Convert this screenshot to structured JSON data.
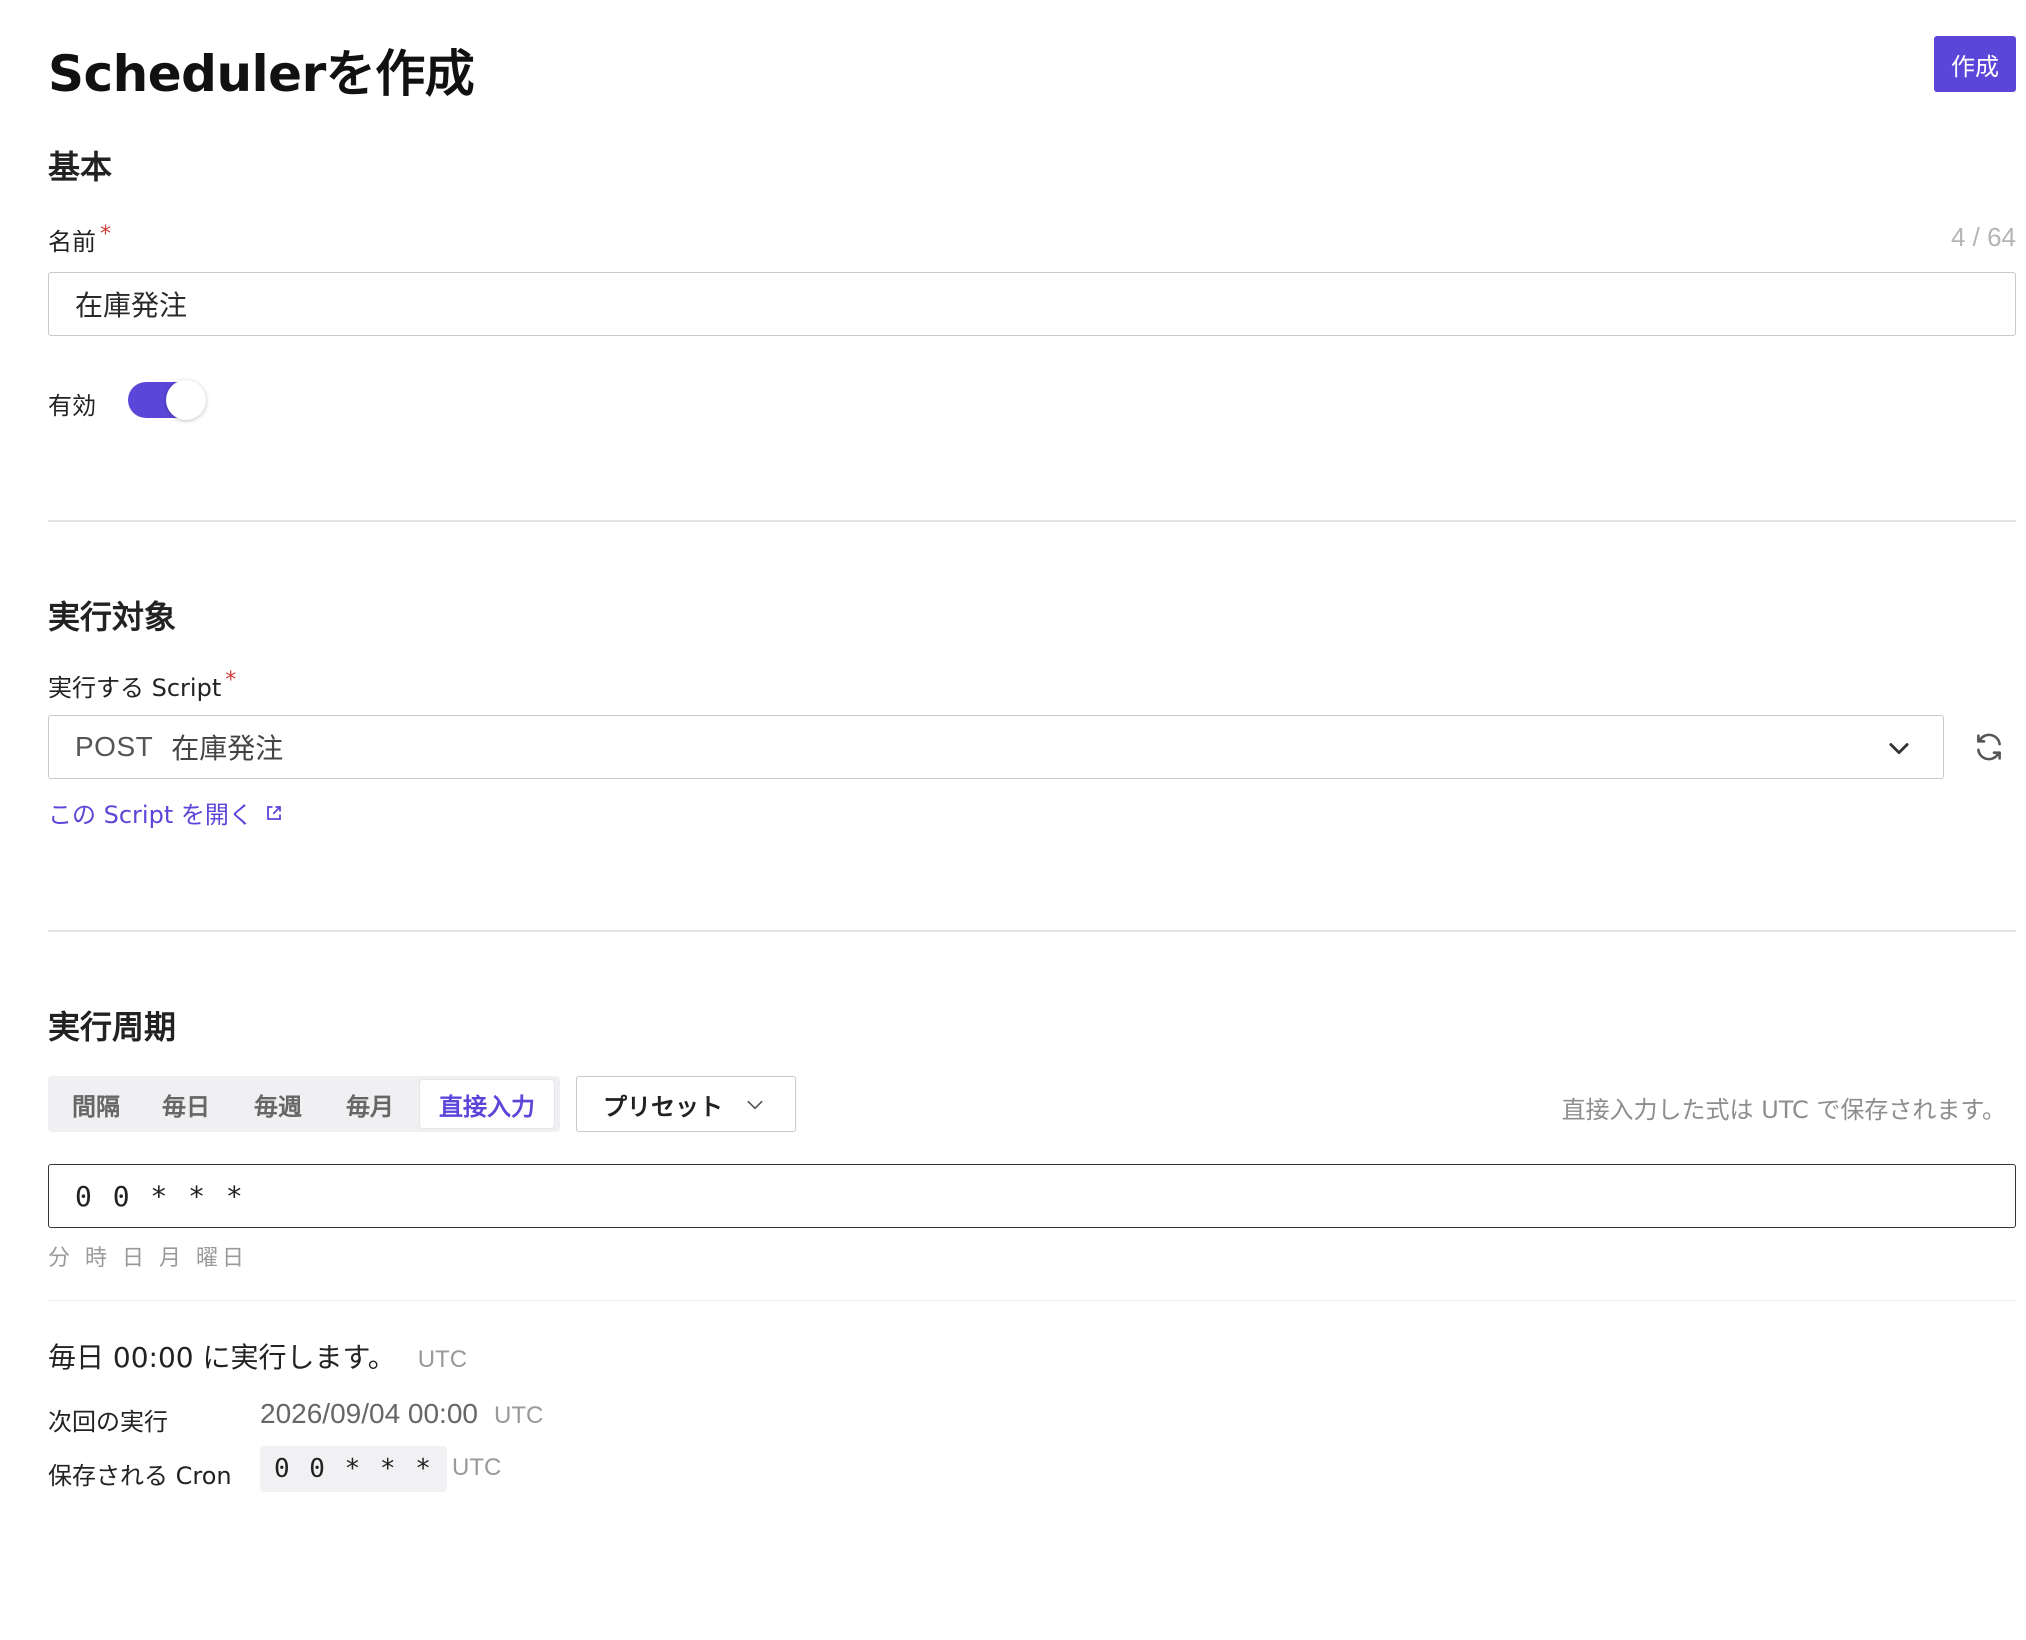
{
  "page": {
    "title": "Schedulerを作成",
    "create_button": "作成"
  },
  "basic": {
    "section_title": "基本",
    "name_label": "名前",
    "required_mark": "*",
    "name_counter": "4 / 64",
    "name_value": "在庫発注",
    "enabled_label": "有効",
    "enabled": true
  },
  "target": {
    "section_title": "実行対象",
    "script_label": "実行する Script",
    "required_mark": "*",
    "selected_method": "POST",
    "selected_name": "在庫発注",
    "open_link": "この Script を開く"
  },
  "schedule": {
    "section_title": "実行周期",
    "tabs": [
      "間隔",
      "毎日",
      "毎週",
      "毎月",
      "直接入力"
    ],
    "active_tab": "直接入力",
    "preset_label": "プリセット",
    "hint": "直接入力した式は UTC で保存されます。",
    "cron_value": "0 0 * * *",
    "cron_legend": "分 時 日 月 曜日",
    "summary": "毎日 00:00 に実行します。",
    "summary_tz": "UTC",
    "next_run_label": "次回の実行",
    "next_run_value": "2026/09/04 00:00",
    "next_run_tz": "UTC",
    "saved_cron_label": "保存される Cron",
    "saved_cron_value": "0 0 * * *",
    "saved_cron_tz": "UTC"
  },
  "colors": {
    "accent": "#5b46d9",
    "required": "#d23a3a"
  }
}
